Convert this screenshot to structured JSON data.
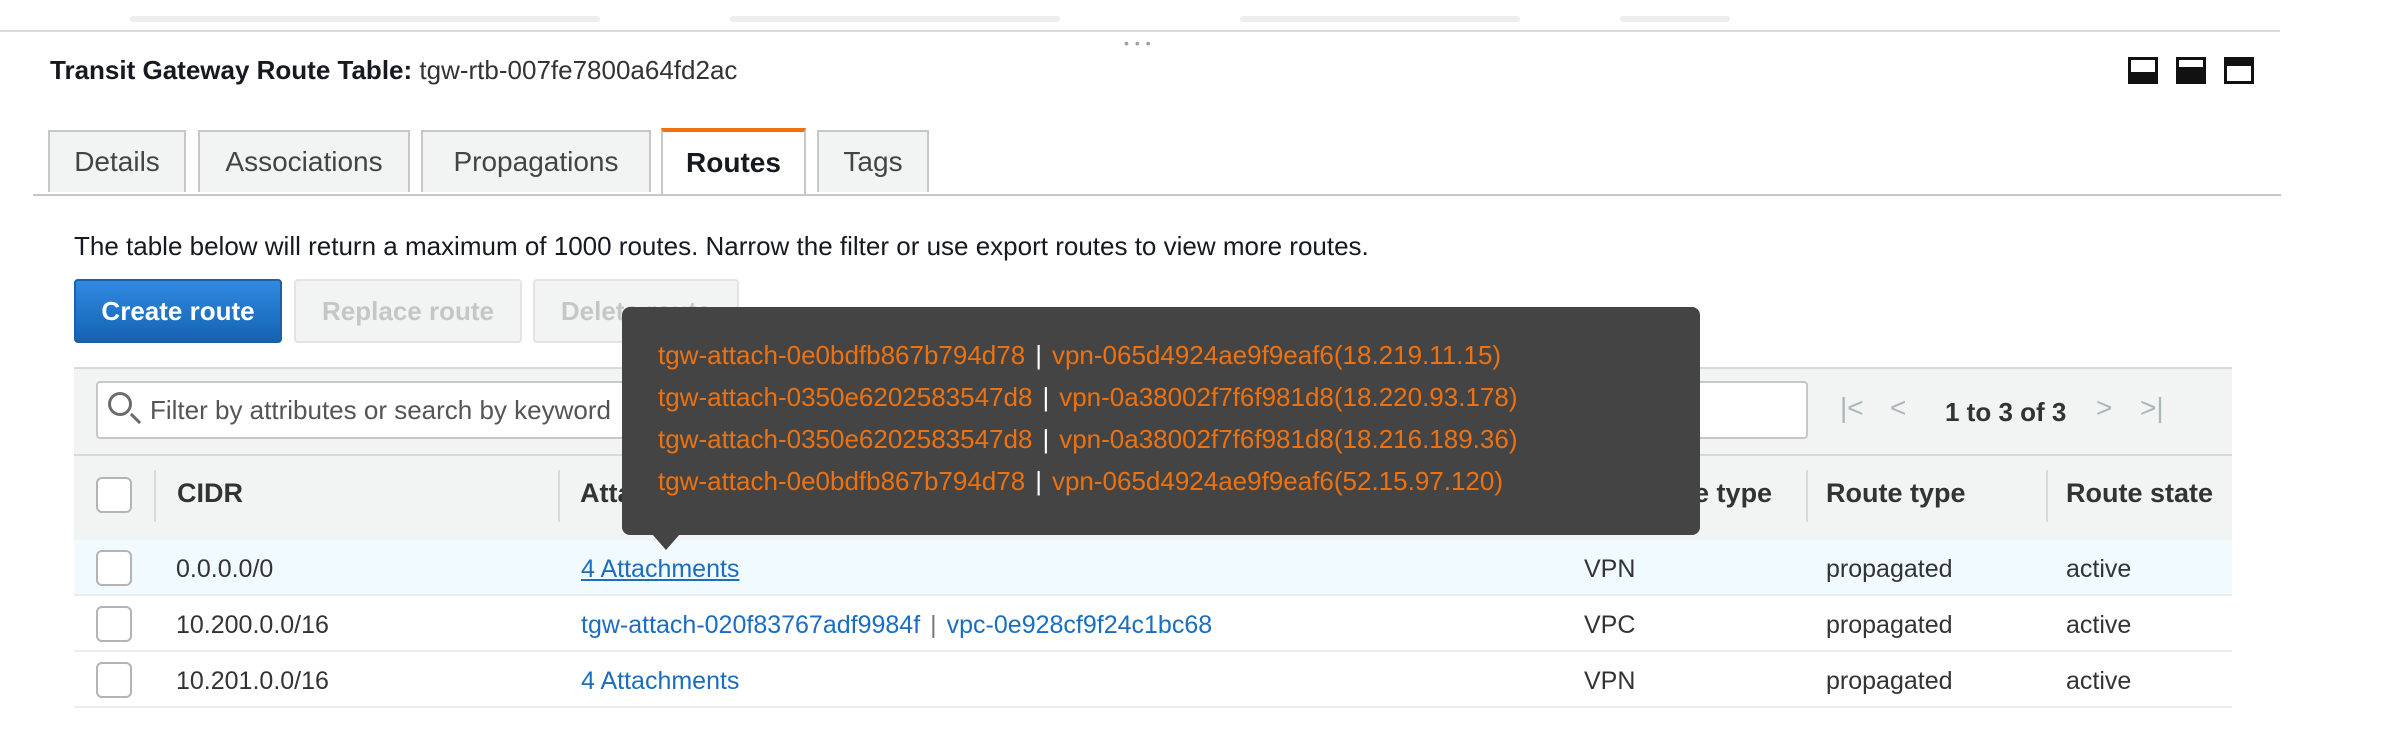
{
  "header": {
    "label": "Transit Gateway Route Table:",
    "value": "tgw-rtb-007fe7800a64fd2ac"
  },
  "tabs": [
    {
      "label": "Details",
      "active": false
    },
    {
      "label": "Associations",
      "active": false
    },
    {
      "label": "Propagations",
      "active": false
    },
    {
      "label": "Routes",
      "active": true
    },
    {
      "label": "Tags",
      "active": false
    }
  ],
  "info_text": "The table below will return a maximum of 1000 routes. Narrow the filter or use export routes to view more routes.",
  "buttons": {
    "create": "Create route",
    "replace": "Replace route",
    "delete": "Delete route"
  },
  "filter": {
    "placeholder": "Filter by attributes or search by keyword"
  },
  "pagination": {
    "text": "1 to 3 of 3"
  },
  "table": {
    "columns": [
      "CIDR",
      "Attachment",
      "Resource type",
      "Route type",
      "Route state"
    ],
    "rows": [
      {
        "cidr": "0.0.0.0/0",
        "attachment": "4 Attachments",
        "resource_type": "VPN",
        "route_type": "propagated",
        "route_state": "active"
      },
      {
        "cidr": "10.200.0.0/16",
        "attachment_id": "tgw-attach-020f83767adf9984f",
        "attachment_resource": "vpc-0e928cf9f24c1bc68",
        "resource_type": "VPC",
        "route_type": "propagated",
        "route_state": "active"
      },
      {
        "cidr": "10.201.0.0/16",
        "attachment": "4 Attachments",
        "resource_type": "VPN",
        "route_type": "propagated",
        "route_state": "active"
      }
    ]
  },
  "tooltip": {
    "separator": "|",
    "lines": [
      {
        "attachment": "tgw-attach-0e0bdfb867b794d78",
        "resource": "vpn-065d4924ae9f9eaf6(18.219.11.15)"
      },
      {
        "attachment": "tgw-attach-0350e6202583547d8",
        "resource": "vpn-0a38002f7f6f981d8(18.220.93.178)"
      },
      {
        "attachment": "tgw-attach-0350e6202583547d8",
        "resource": "vpn-0a38002f7f6f981d8(18.216.189.36)"
      },
      {
        "attachment": "tgw-attach-0e0bdfb867b794d78",
        "resource": "vpn-065d4924ae9f9eaf6(52.15.97.120)"
      }
    ]
  },
  "colors": {
    "accent_orange": "#ec7211",
    "primary_blue": "#1a6dbf",
    "tooltip_bg": "#444444"
  }
}
